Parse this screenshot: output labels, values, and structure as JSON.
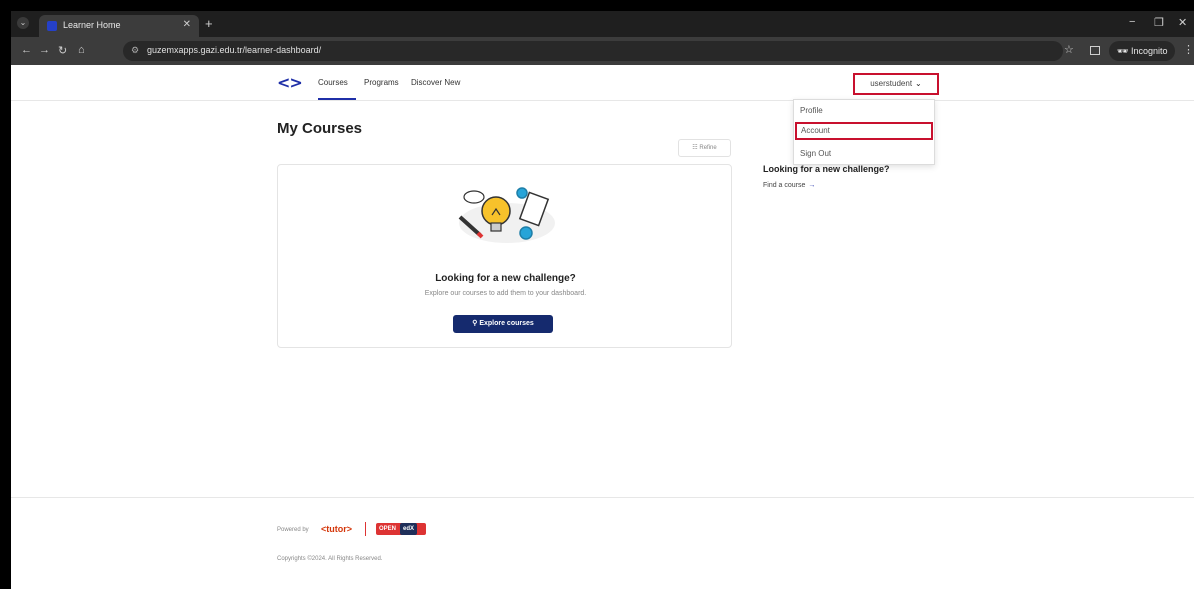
{
  "browser": {
    "tab_title": "Learner Home",
    "tab_close": "✕",
    "new_tab": "+",
    "url": "guzemxapps.gazi.edu.tr/learner-dashboard/",
    "incognito_label": "Incognito",
    "win_minimize": "−",
    "win_restore": "❐",
    "win_close": "✕"
  },
  "header": {
    "logo": "<>",
    "nav": [
      "Courses",
      "Programs",
      "Discover New"
    ],
    "user_label": "userstudent",
    "user_chevron": "⌄"
  },
  "dropdown": {
    "items": [
      "Profile",
      "Account",
      "Sign Out"
    ]
  },
  "main": {
    "title": "My Courses",
    "refine_label": "Refine",
    "empty_heading": "Looking for a new challenge?",
    "empty_sub": "Explore our courses to add them to your dashboard.",
    "explore_label": "Explore courses"
  },
  "sidebar": {
    "heading": "Looking for a new challenge?",
    "link_label": "Find a course"
  },
  "footer": {
    "powered_by": "Powered by",
    "tutor": "<tutor>",
    "openedx_open": "OPEN",
    "openedx_edx": "edX",
    "copyright": "Copyrights ©2024. All Rights Reserved."
  },
  "colors": {
    "brand": "#1f2fa8",
    "highlight": "#c8102e",
    "button": "#152a6e"
  }
}
